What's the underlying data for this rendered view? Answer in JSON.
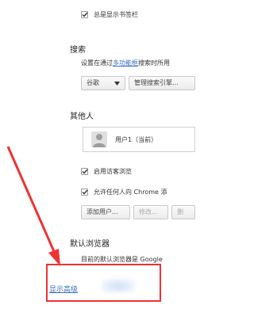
{
  "colors": {
    "accent_link": "#3a6fc4",
    "annotation_red": "#ee3333",
    "text": "#333333"
  },
  "appearance": {
    "bookmark_bar_label": "总是显示书签栏",
    "bookmark_bar_checked": true
  },
  "search": {
    "title": "搜索",
    "description_prefix": "设置在通过",
    "description_link": "多功能框",
    "description_suffix": "搜索时所用",
    "engine_select_value": "谷歌",
    "manage_button": "管理搜索引擎..."
  },
  "people": {
    "title": "其他人",
    "profile_name": "用户1（当前）",
    "guest_browsing_label": "启用访客浏览",
    "guest_browsing_checked": true,
    "allow_add_label": "允许任何人向 Chrome 添",
    "allow_add_checked": true,
    "add_user_button": "添加用户...",
    "edit_button": "修改...",
    "delete_button": "删"
  },
  "default_browser": {
    "title": "默认浏览器",
    "description": "目前的默认浏览器是 Google"
  },
  "advanced": {
    "show_advanced_link": "显示高级"
  },
  "icons": {
    "checkmark": "check-icon",
    "dropdown": "triangle-down-icon",
    "avatar": "user-silhouette-icon",
    "arrow": "red-arrow-annotation-icon"
  }
}
